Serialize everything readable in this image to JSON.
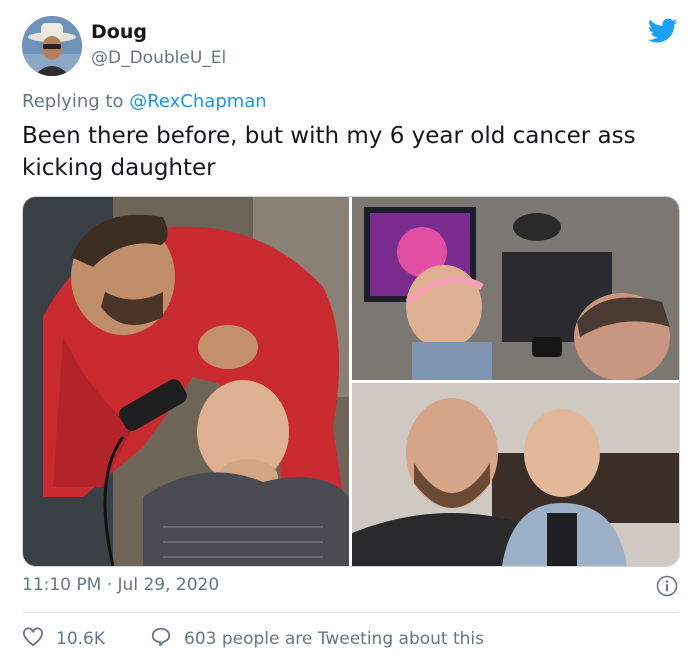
{
  "author": {
    "name": "Doug",
    "handle": "@D_DoubleU_El"
  },
  "reply": {
    "prefix": "Replying to ",
    "mention": "@RexChapman"
  },
  "tweet": {
    "text": "Been there before, but with my 6 year old cancer ass kicking daughter"
  },
  "meta": {
    "timestamp": "11:10 PM · Jul 29, 2020"
  },
  "actions": {
    "likes": "10.6K",
    "talking": "603 people are Tweeting about this"
  },
  "icons": {
    "brand": "twitter-bird-icon",
    "info": "info-icon",
    "like": "heart-icon",
    "reply": "speech-bubble-icon"
  },
  "colors": {
    "brand": "#1da1f2",
    "mention": "#1b95e0",
    "muted": "#657786"
  }
}
